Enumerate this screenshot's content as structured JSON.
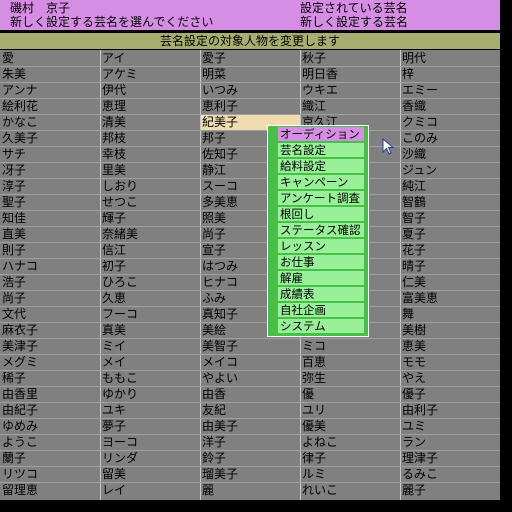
{
  "header": {
    "name": "磯村　京子",
    "instruction": "新しく設定する芸名を選んでください",
    "current_label": "設定されている芸名",
    "new_label": "新しく設定する芸名"
  },
  "banner": "芸名設定の対象人物を変更します",
  "grid": {
    "rows": [
      [
        "愛",
        "アイ",
        "愛子",
        "秋子",
        "明代"
      ],
      [
        "朱美",
        "アケミ",
        "明菜",
        "明日香",
        "梓"
      ],
      [
        "アンナ",
        "伊代",
        "いつみ",
        "ウキエ",
        "エミー"
      ],
      [
        "絵利花",
        "恵理",
        "恵利子",
        "織江",
        "香織"
      ],
      [
        "かなこ",
        "清美",
        "紀美子",
        "京久江",
        "クミコ"
      ],
      [
        "久美子",
        "邦枝",
        "邦子",
        "",
        "このみ"
      ],
      [
        "サチ",
        "幸枝",
        "佐知子",
        "",
        "沙織"
      ],
      [
        "冴子",
        "里美",
        "静江",
        "",
        "ジュン"
      ],
      [
        "淳子",
        "しおり",
        "スーコ",
        "",
        "純江"
      ],
      [
        "聖子",
        "せつこ",
        "多美恵",
        "",
        "智鶴"
      ],
      [
        "知佳",
        "輝子",
        "照美",
        "",
        "智子"
      ],
      [
        "直美",
        "奈緒美",
        "尚子",
        "",
        "夏子"
      ],
      [
        "則子",
        "信江",
        "宣子",
        "",
        "花子"
      ],
      [
        "ハナコ",
        "初子",
        "はつみ",
        "",
        "晴子"
      ],
      [
        "浩子",
        "ひろこ",
        "ヒナコ",
        "",
        "仁美"
      ],
      [
        "尚子",
        "久恵",
        "ふみ",
        "",
        "富美恵"
      ],
      [
        "文代",
        "フーコ",
        "真知子",
        "",
        "舞"
      ],
      [
        "麻衣子",
        "真美",
        "美絵",
        "",
        "美樹"
      ],
      [
        "美津子",
        "ミイ",
        "美智子",
        "ミコ",
        "恵美"
      ],
      [
        "メグミ",
        "メイ",
        "メイコ",
        "百恵",
        "モモ"
      ],
      [
        "稀子",
        "ももこ",
        "やよい",
        "弥生",
        "やえ"
      ],
      [
        "由香里",
        "ゆかり",
        "由香",
        "優",
        "優子"
      ],
      [
        "由紀子",
        "ユキ",
        "友紀",
        "ユリ",
        "由利子"
      ],
      [
        "ゆめみ",
        "夢子",
        "由美子",
        "優美",
        "ユミ"
      ],
      [
        "ようこ",
        "ヨーコ",
        "洋子",
        "よねこ",
        "ラン"
      ],
      [
        "蘭子",
        "リンダ",
        "鈴子",
        "律子",
        "理津子"
      ],
      [
        "リツコ",
        "留美",
        "瑠美子",
        "ルミ",
        "るみこ"
      ],
      [
        "留理恵",
        "レイ",
        "麗",
        "れいこ",
        "麗子"
      ]
    ],
    "selected": {
      "row": 4,
      "col": 2
    }
  },
  "menu": {
    "items": [
      "オーディション",
      "芸名設定",
      "給料設定",
      "キャンペーン",
      "アンケート調査",
      "根回し",
      "ステータス確認",
      "レッスン",
      "お仕事",
      "解雇",
      "成績表",
      "自社企画",
      "システム"
    ],
    "active_index": 0
  },
  "colors": {
    "header_bg": "#d68ee4",
    "banner_bg": "#a8ae70",
    "grid_bg": "#808080",
    "selected_cell": "#f0dcae",
    "menu_bg": "#48c048",
    "menu_item_bg": "#98f098",
    "menu_active_bg": "#d68ee4"
  },
  "icons": {
    "cursor": "arrow-cursor-icon"
  }
}
